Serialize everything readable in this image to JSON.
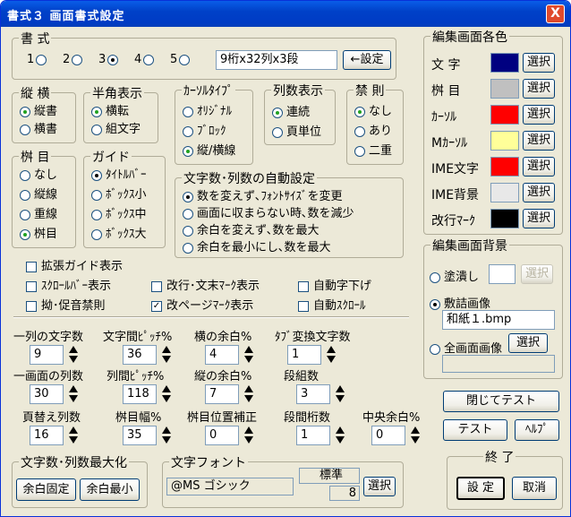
{
  "window": {
    "title": "書式３ 画面書式設定",
    "close": "X"
  },
  "format": {
    "title": "書 式",
    "radios": [
      "1",
      "2",
      "3",
      "4",
      "5"
    ],
    "selected": 3,
    "value": "9桁x32列x3段",
    "set_button": "←設定"
  },
  "vertical": {
    "title": "縦 横",
    "options": [
      "縦書",
      "横書"
    ],
    "selected": 0
  },
  "halfwidth": {
    "title": "半角表示",
    "options": [
      "横転",
      "組文字"
    ],
    "selected": 0
  },
  "cursor": {
    "title": "ｶｰｿﾙﾀｲﾌﾟ",
    "options": [
      "ｵﾘｼﾞﾅﾙ",
      "ﾌﾞﾛｯｸ",
      "縦/横線"
    ],
    "selected": 2
  },
  "columns": {
    "title": "列数表示",
    "options": [
      "連続",
      "頁単位"
    ],
    "selected": 0
  },
  "kinsoku": {
    "title": "禁 則",
    "options": [
      "なし",
      "あり",
      "二重"
    ],
    "selected": 0
  },
  "keime": {
    "title": "桝 目",
    "options": [
      "なし",
      "縦線",
      "重線",
      "桝目"
    ],
    "selected": 3
  },
  "guide": {
    "title": "ガイド",
    "options": [
      "ﾀｲﾄﾙﾊﾞｰ",
      "ﾎﾞｯｸｽ小",
      "ﾎﾞｯｸｽ中",
      "ﾎﾞｯｸｽ大"
    ],
    "selected": 0
  },
  "auto": {
    "title": "文字数･列数の自動設定",
    "options": [
      "数を変えず､ﾌｫﾝﾄｻｲｽﾞを変更",
      "画面に収まらない時､数を減少",
      "余白を変えず､数を最大",
      "余白を最小にし､数を最大"
    ],
    "selected": 0
  },
  "checks": {
    "ext_guide": "拡張ガイド表示",
    "scrollbar": "ｽｸﾛｰﾙﾊﾞｰ表示",
    "kaigyo": "改行･文末ﾏｰｸ表示",
    "auto_down": "自動字下げ",
    "sokuon": "拗･促音禁則",
    "page_mark": "改ページﾏｰｸ表示",
    "auto_scroll": "自動ｽｸﾛｰﾙ",
    "page_mark_checked": true,
    "check_glyph": "✓"
  },
  "params": {
    "row1": [
      {
        "label": "一列の文字数",
        "value": "9"
      },
      {
        "label": "文字間ﾋﾟｯﾁ%",
        "value": "36"
      },
      {
        "label": "横の余白%",
        "value": "4"
      },
      {
        "label": "ﾀﾌﾞ変換文字数",
        "value": "1"
      }
    ],
    "row2": [
      {
        "label": "一画面の列数",
        "value": "30"
      },
      {
        "label": "列間ﾋﾟｯﾁ%",
        "value": "118"
      },
      {
        "label": "縦の余白%",
        "value": "7"
      },
      {
        "label": "段組数",
        "value": "3"
      }
    ],
    "row3": [
      {
        "label": "頁替え列数",
        "value": "16"
      },
      {
        "label": "桝目幅%",
        "value": "35"
      },
      {
        "label": "桝目位置補正",
        "value": "0"
      },
      {
        "label": "段間桁数",
        "value": "1"
      },
      {
        "label": "中央余白%",
        "value": "0"
      }
    ]
  },
  "maximize": {
    "title": "文字数･列数最大化",
    "btn1": "余白固定",
    "btn2": "余白最小"
  },
  "font": {
    "title": "文字フォント",
    "name": "@MS ゴシック",
    "style": "標準",
    "size": "8",
    "select": "選択"
  },
  "colors": {
    "title": "編集画面各色",
    "select": "選択",
    "items": [
      {
        "label": "文 字",
        "color": "#000080"
      },
      {
        "label": "桝 目",
        "color": "#c0c0c0"
      },
      {
        "label": "ｶｰｿﾙ",
        "color": "#ff0000"
      },
      {
        "label": "Mｶｰｿﾙ",
        "color": "#ffff99"
      },
      {
        "label": "IME文字",
        "color": "#ff0000"
      },
      {
        "label": "IME背景",
        "color": "#e8e8e8"
      },
      {
        "label": "改行ﾏｰｸ",
        "color": "#000000"
      }
    ]
  },
  "background": {
    "title": "編集画面背景",
    "fill": "塗潰し",
    "fill_color": "#ffffff",
    "paper": "敷詰画像",
    "paper_file": "和紙１.bmp",
    "full": "全画面画像",
    "select": "選択",
    "full_file": "",
    "selected": 1
  },
  "buttons": {
    "close_test": "閉じてテスト",
    "test": "テスト",
    "help": "ﾍﾙﾌﾟ"
  },
  "finish": {
    "title": "終 了",
    "ok": "設 定",
    "cancel": "取消"
  }
}
